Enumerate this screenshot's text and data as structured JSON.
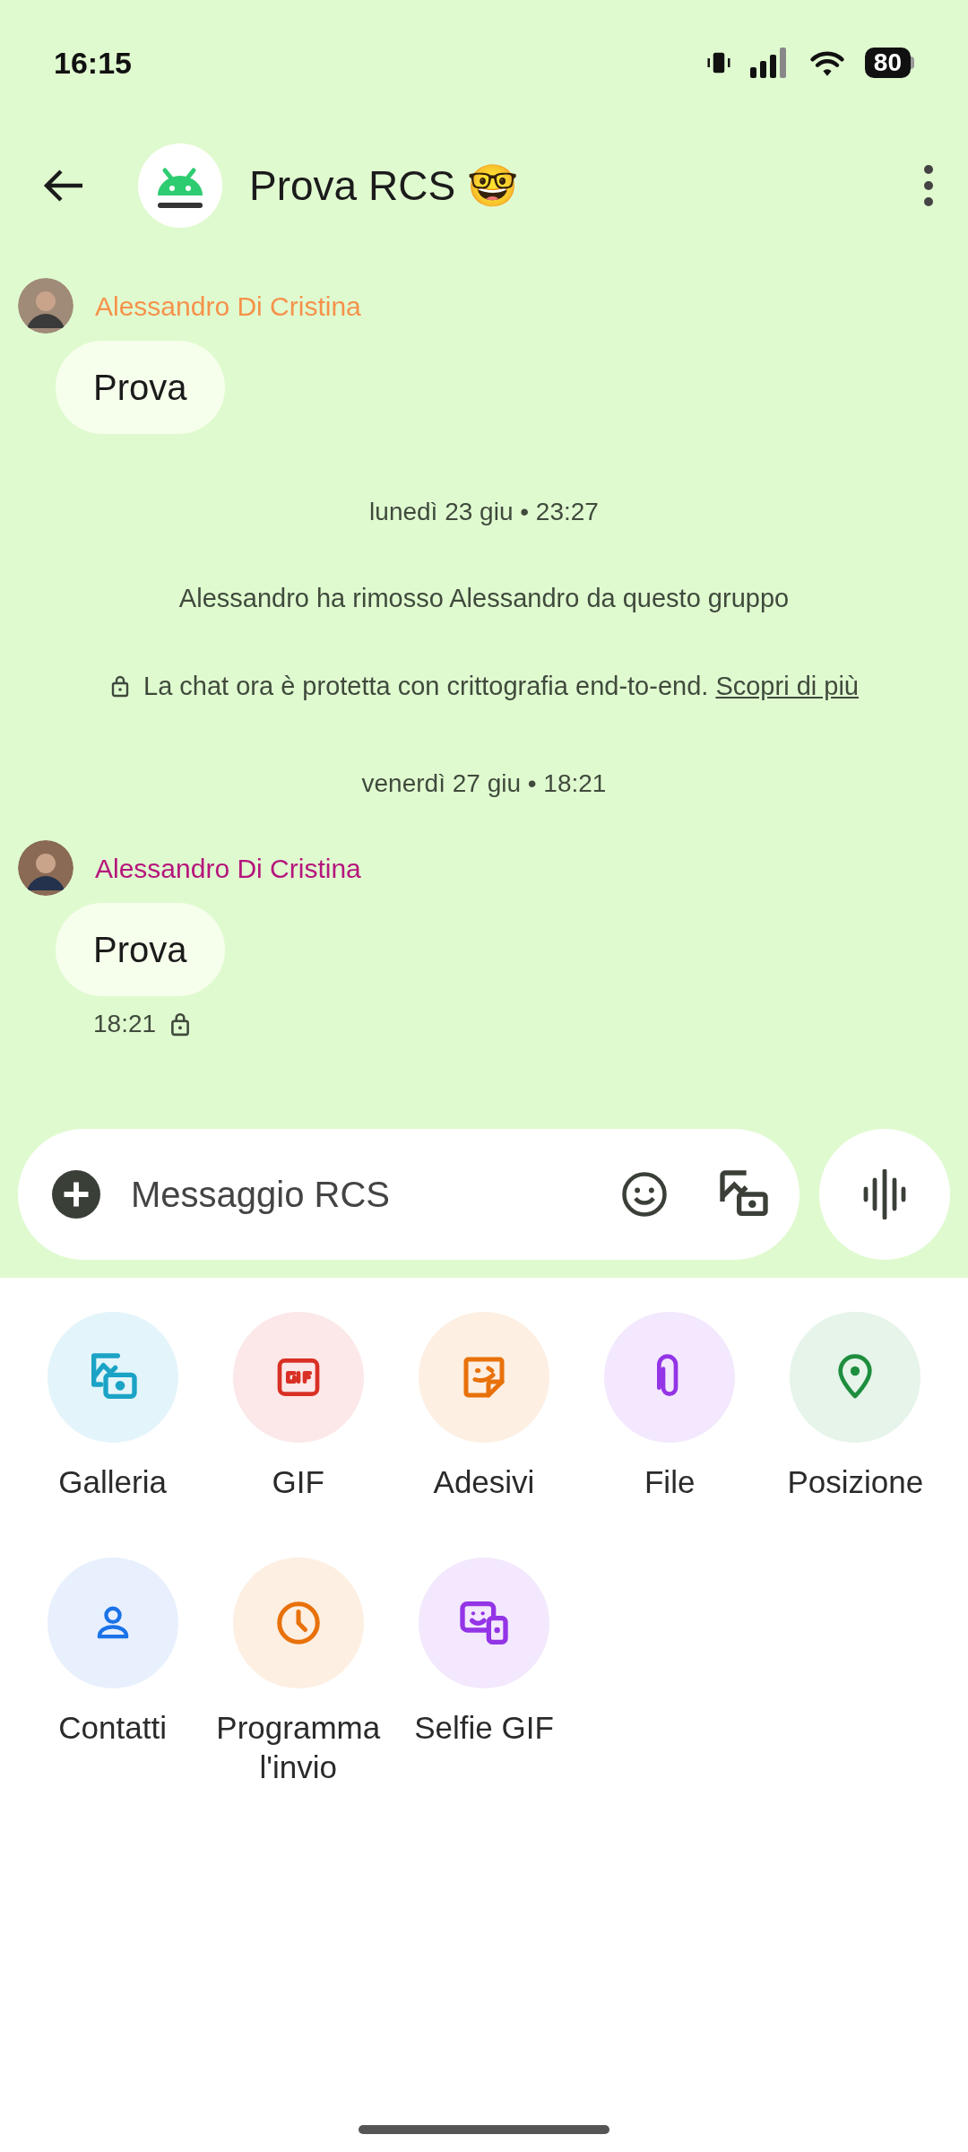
{
  "status_bar": {
    "time": "16:15",
    "battery": "80"
  },
  "header": {
    "title": "Prova RCS 🤓"
  },
  "messages": [
    {
      "kind": "message",
      "sender": "Alessandro Di Cristina",
      "color": "#f5924a",
      "text": "Prova"
    },
    {
      "kind": "date",
      "text": "lunedì 23 giu • 23:27"
    },
    {
      "kind": "system",
      "text": "Alessandro ha rimosso Alessandro da questo gruppo"
    },
    {
      "kind": "encryption",
      "text": "La chat ora è protetta con crittografia end-to-end.",
      "link": "Scopri di più"
    },
    {
      "kind": "date",
      "text": "venerdì 27 giu • 18:21"
    },
    {
      "kind": "message",
      "sender": "Alessandro Di Cristina",
      "color": "#b5157c",
      "text": "Prova",
      "time": "18:21",
      "locked": true
    }
  ],
  "composer": {
    "placeholder": "Messaggio RCS"
  },
  "attachments": [
    {
      "kind": "gallery",
      "label": "Galleria",
      "color": "#1ba3c6"
    },
    {
      "kind": "gif",
      "label": "GIF",
      "color": "#d93025"
    },
    {
      "kind": "sticker",
      "label": "Adesivi",
      "color": "#e8710a"
    },
    {
      "kind": "file",
      "label": "File",
      "color": "#9334e6"
    },
    {
      "kind": "location",
      "label": "Posizione",
      "color": "#1e8e3e"
    },
    {
      "kind": "contact",
      "label": "Contatti",
      "color": "#1a73e8"
    },
    {
      "kind": "schedule",
      "label": "Programma l'invio",
      "color": "#e8710a"
    },
    {
      "kind": "selfie",
      "label": "Selfie GIF",
      "color": "#9334e6"
    }
  ]
}
